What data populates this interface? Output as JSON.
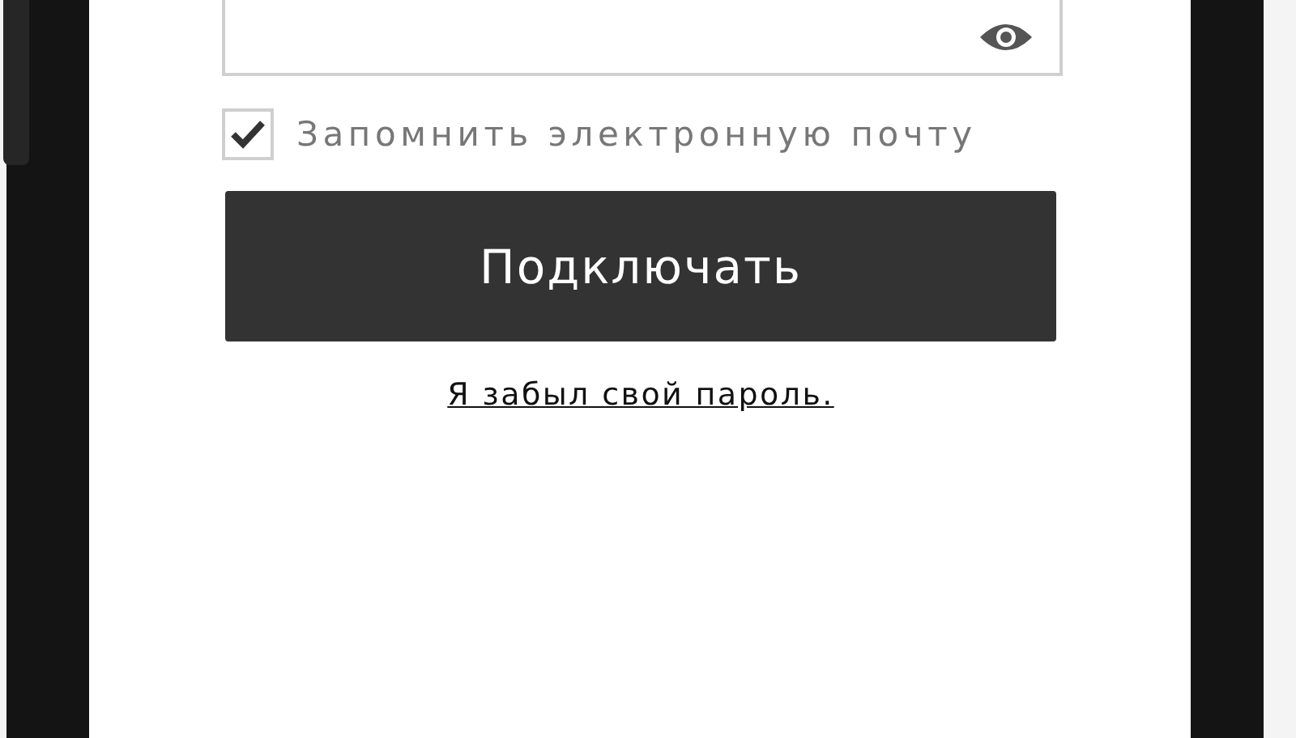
{
  "remember_email": {
    "label": "Запомнить электронную почту",
    "checked": true
  },
  "connect_button": {
    "label": "Подключать"
  },
  "forgot_link": {
    "label": "Я забыл свой пароль."
  }
}
